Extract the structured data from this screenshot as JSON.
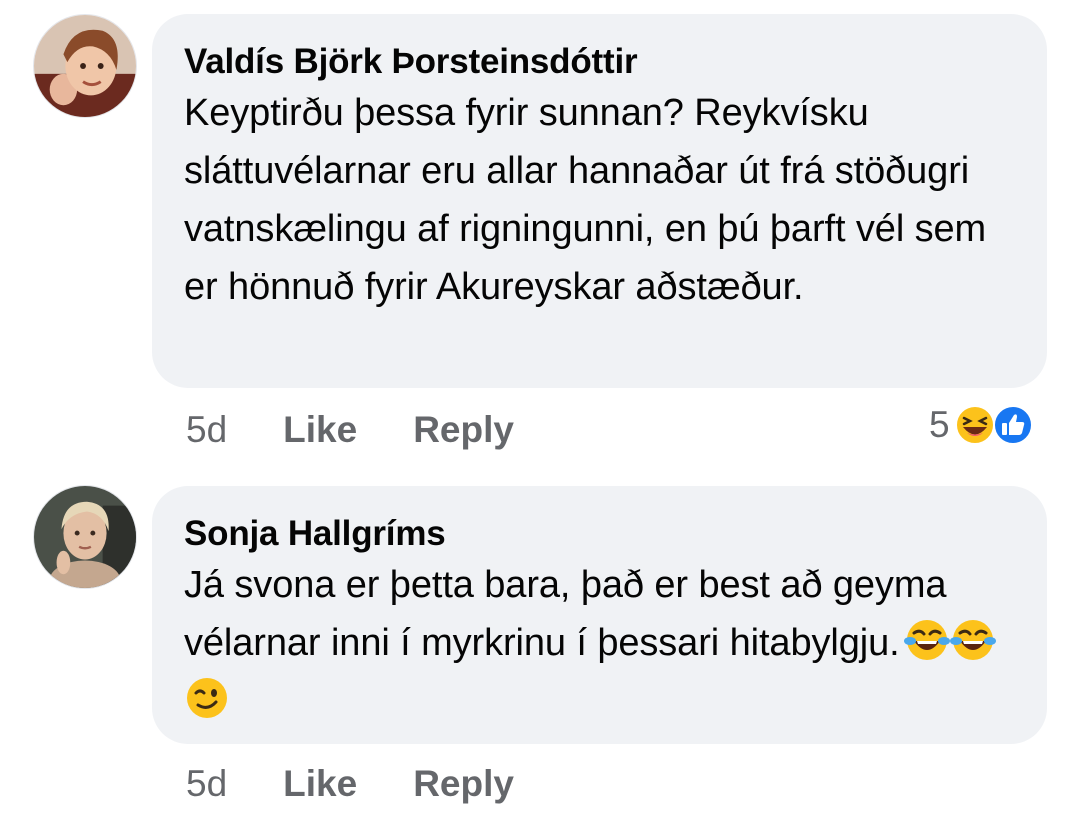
{
  "comments": [
    {
      "author": "Valdís Björk Þorsteinsdóttir",
      "text": "Keyptirðu þessa fyrir sunnan? Reykvísku sláttuvélarnar eru allar hannaðar út frá stöðugri vatnskælingu af rigningunni, en þú þarft vél sem er hönnuð fyrir Akureyskar aðstæður.",
      "time": "5d",
      "like_label": "Like",
      "reply_label": "Reply",
      "reaction_count": "5",
      "reactions": [
        "haha-reaction-icon",
        "like-reaction-icon"
      ]
    },
    {
      "author": "Sonja Hallgríms",
      "text": "Já svona er þetta bara, það er best að geyma vélarnar inni í myrkrinu í þessari hitabylgju.",
      "emojis": [
        "tears-of-joy-emoji",
        "tears-of-joy-emoji",
        "winking-face-emoji"
      ],
      "time": "5d",
      "like_label": "Like",
      "reply_label": "Reply"
    }
  ],
  "colors": {
    "bubble": "#f0f2f5",
    "meta_text": "#65676b",
    "like_blue": "#1877f2",
    "emoji_yellow": "#fcc21b"
  }
}
